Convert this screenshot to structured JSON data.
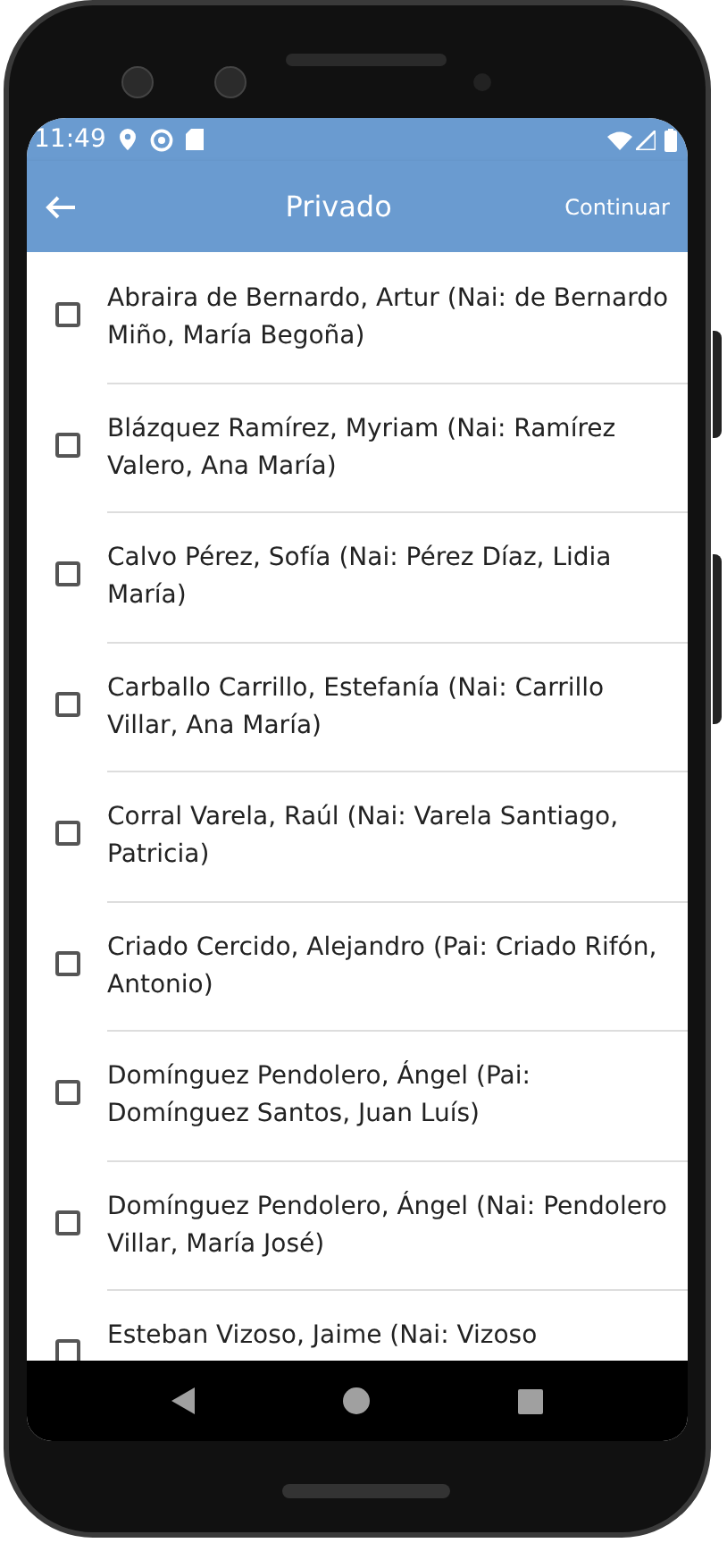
{
  "status_bar": {
    "time": "11:49"
  },
  "app_bar": {
    "title": "Privado",
    "action": "Continuar"
  },
  "items": [
    {
      "label": "Abraira de Bernardo, Artur (Nai: de Bernardo Miño, María Begoña)",
      "checked": false
    },
    {
      "label": "Blázquez Ramírez, Myriam (Nai: Ramírez Valero, Ana María)",
      "checked": false
    },
    {
      "label": "Calvo Pérez, Sofía (Nai: Pérez Díaz, Lidia María)",
      "checked": false
    },
    {
      "label": "Carballo Carrillo, Estefanía (Nai: Carrillo Villar, Ana María)",
      "checked": false
    },
    {
      "label": "Corral Varela, Raúl (Nai: Varela Santiago, Patricia)",
      "checked": false
    },
    {
      "label": "Criado Cercido, Alejandro (Pai: Criado Rifón, Antonio)",
      "checked": false
    },
    {
      "label": "Domínguez Pendolero, Ángel (Pai: Domínguez Santos, Juan Luís)",
      "checked": false
    },
    {
      "label": "Domínguez Pendolero, Ángel (Nai: Pendolero Villar, María José)",
      "checked": false
    },
    {
      "label": "Esteban Vizoso, Jaime (Nai: Vizoso",
      "checked": false
    }
  ]
}
